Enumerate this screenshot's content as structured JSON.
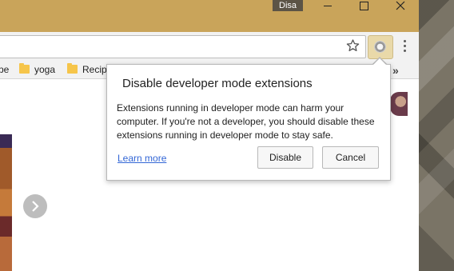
{
  "titlebar": {
    "badge": "Disa"
  },
  "bookmarks": {
    "partial": "pe",
    "items": [
      {
        "label": "yoga",
        "icon": "folder-icon"
      },
      {
        "label": "Recipe",
        "icon": "folder-icon"
      }
    ],
    "more": "»"
  },
  "popup": {
    "title": "Disable developer mode extensions",
    "body": "Extensions running in developer mode can harm your computer. If you're not a developer, you should disable these extensions running in developer mode to stay safe.",
    "learn_more": "Learn more",
    "disable_label": "Disable",
    "cancel_label": "Cancel"
  },
  "colors": {
    "titlebar": "#c9a45a",
    "link": "#3367d6",
    "folder": "#f6c54a"
  }
}
